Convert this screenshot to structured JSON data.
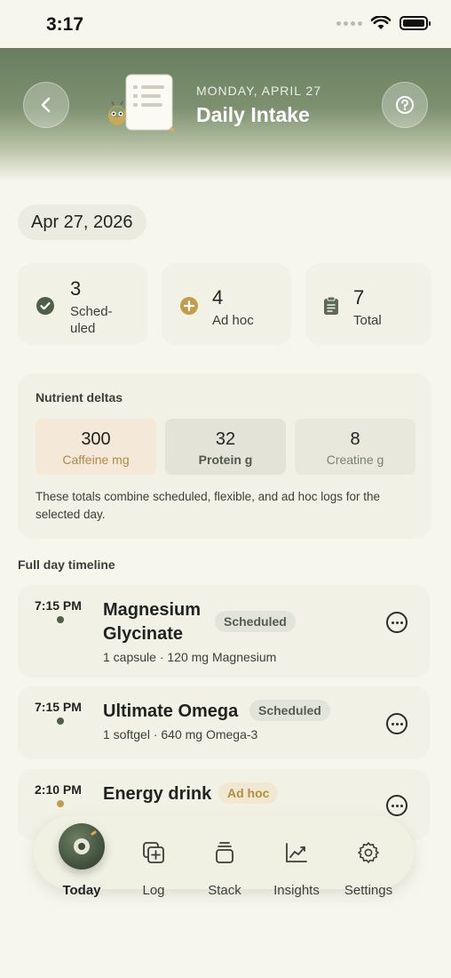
{
  "status_bar": {
    "time": "3:17"
  },
  "header": {
    "date_caption": "MONDAY, APRIL 27",
    "title": "Daily Intake",
    "back_icon": "chevron-left-icon",
    "help_icon": "question-circle-icon"
  },
  "date_pill": "Apr 27, 2026",
  "stats": [
    {
      "value": "3",
      "label_line1": "Sched-",
      "label_line2": "uled",
      "icon": "check-circle-icon",
      "color": "#4e6146"
    },
    {
      "value": "4",
      "label": "Ad hoc",
      "icon": "plus-circle-icon",
      "color": "#c49b4a"
    },
    {
      "value": "7",
      "label": "Total",
      "icon": "clipboard-icon",
      "color": "#5d6a57"
    }
  ],
  "nutrients": {
    "title": "Nutrient deltas",
    "items": [
      {
        "value": "300",
        "label": "Caffeine mg",
        "bg": "#f4e8d8",
        "label_color": "#b08a45"
      },
      {
        "value": "32",
        "label": "Protein g",
        "bg": "#e3e3d8",
        "label_color": "#4f5a49"
      },
      {
        "value": "8",
        "label": "Creatine g",
        "bg": "#e8e8dd",
        "label_color": "#7a8172"
      }
    ],
    "note": "These totals combine scheduled, flexible, and ad hoc logs for the selected day."
  },
  "timeline": {
    "label": "Full day timeline",
    "entries": [
      {
        "time": "7:15 PM",
        "name_line1": "Magnesium",
        "name_line2": "Glycinate",
        "badge": "Scheduled",
        "detail": "1 capsule · 120 mg Magnesium",
        "dot_color": "#4e6146"
      },
      {
        "time": "7:15 PM",
        "name": "Ultimate Omega",
        "badge": "Scheduled",
        "detail": "1 softgel · 640 mg Omega-3",
        "dot_color": "#4e6146"
      },
      {
        "time": "2:10 PM",
        "name": "Energy drink",
        "badge": "Ad hoc",
        "dot_color": "#c49b4a"
      }
    ]
  },
  "tabs": [
    {
      "label": "Today",
      "icon": "today-orb-icon",
      "active": true
    },
    {
      "label": "Log",
      "icon": "add-square-icon"
    },
    {
      "label": "Stack",
      "icon": "stack-icon"
    },
    {
      "label": "Insights",
      "icon": "chart-line-icon"
    },
    {
      "label": "Settings",
      "icon": "gear-icon"
    }
  ],
  "colors": {
    "accent": "#4e6146",
    "adhoc": "#c49b4a",
    "background": "#f7f6ec"
  }
}
